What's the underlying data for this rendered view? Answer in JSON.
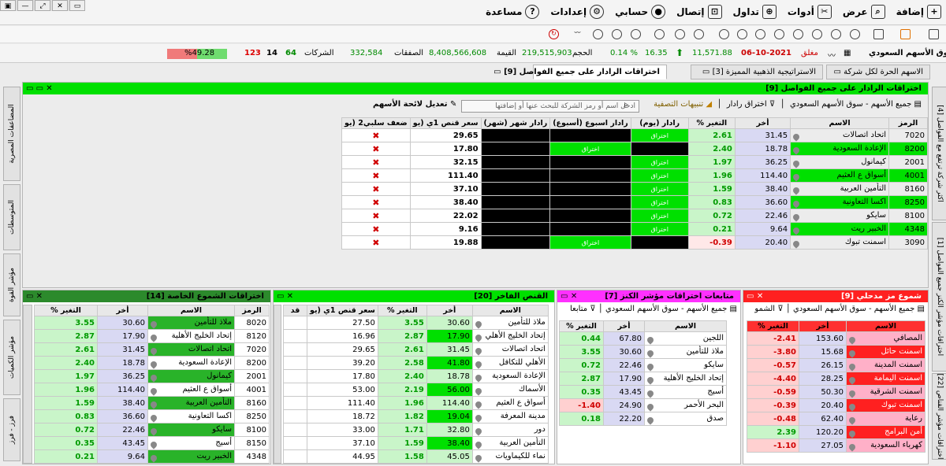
{
  "window_controls": [
    "▣",
    "—",
    "⤢",
    "✕",
    "▭"
  ],
  "menu": [
    {
      "label": "إضافة",
      "icon": "add-icon"
    },
    {
      "label": "عرض",
      "icon": "view-icon"
    },
    {
      "label": "أدوات",
      "icon": "tools-icon"
    },
    {
      "label": "تداول",
      "icon": "cart-icon"
    },
    {
      "label": "إتصال",
      "icon": "connect-icon"
    },
    {
      "label": "حسابي",
      "icon": "account-icon"
    },
    {
      "label": "إعدادات",
      "icon": "gear-icon"
    },
    {
      "label": "مساعدة",
      "icon": "help-icon"
    }
  ],
  "status": {
    "market": "سوق الأسهم السعودي",
    "state": "مغلق",
    "date": "06-10-2021",
    "index": "11,571.88",
    "change": "16.35",
    "change_pct": "0.14 %",
    "volume_label": "الحجم",
    "volume": "219,515,903",
    "value_label": "القيمة",
    "value": "8,408,566,608",
    "deals_label": "الصفقات",
    "deals": "332,584",
    "companies_label": "الشركات",
    "up": "64",
    "flat": "14",
    "down": "123",
    "breadth": "%49.28"
  },
  "tabs": [
    {
      "label": "الاسهم الحرة لكل شركة"
    },
    {
      "label": "الاستراتيجية الذهبية المميزة [3]"
    },
    {
      "label": "اختراقات الرادار على جميع الفواصل [9]"
    }
  ],
  "right_vtabs": [
    "اكثر شركة ترتفع مع الفواصل [4]",
    "اختراقات مؤشر الكنز جميع الفواصل [1]",
    "اختراقات موجة مع تحت خط الحافظ [3]",
    "اختراقات مؤشر القناص [22]"
  ],
  "left_vtabs": [
    "المضاعفات المصرية",
    "المتوسطات",
    "مؤشر القوة",
    "مؤشر الكميات",
    "فرز - فرز"
  ],
  "main": {
    "title": "اختراقات الرادار على جميع الفواصل [9]",
    "market_filter": "جميع الأسهم - سوق الأسهم السعودي",
    "radar_filter": "اختراق رادار",
    "alerts": "تنبيهات التصفية",
    "search_placeholder": "ادخل اسم أو رمز الشركة للبحث عنها أو إضافتها",
    "edit_list": "تعديل لائحة الأسهم",
    "headers": [
      "الرمز",
      "الاسم",
      "أخر",
      "التغير %",
      "رادار (يوم)",
      "رادار اسبوع (أسبوع)",
      "رادار شهر (شهر)",
      "سعر قنص 1ي (يو",
      "ضعف سلبي2 (يو"
    ],
    "rows": [
      {
        "code": "7020",
        "name": "اتحاد اتصالات",
        "last": "31.45",
        "chg": "2.61",
        "day": "اختراق",
        "week": "",
        "month": "bl",
        "snipe": "29.65"
      },
      {
        "code": "8200",
        "name": "الإعادة السعودية",
        "last": "18.78",
        "chg": "2.40",
        "day": "bl",
        "week": "اختراق",
        "month": "bl",
        "snipe": "17.80"
      },
      {
        "code": "2001",
        "name": "كيمانول",
        "last": "36.25",
        "chg": "1.97",
        "day": "اختراق",
        "week": "",
        "month": "bl",
        "snipe": "32.15"
      },
      {
        "code": "4001",
        "name": "أسواق ع العثيم",
        "last": "114.40",
        "chg": "1.96",
        "day": "اختراق",
        "week": "",
        "month": "bl",
        "snipe": "111.40"
      },
      {
        "code": "8160",
        "name": "التأمين العربية",
        "last": "38.40",
        "chg": "1.59",
        "day": "اختراق",
        "week": "",
        "month": "bl",
        "snipe": "37.10"
      },
      {
        "code": "8250",
        "name": "اكسا التعاونية",
        "last": "36.60",
        "chg": "0.83",
        "day": "اختراق",
        "week": "",
        "month": "bl",
        "snipe": "38.40"
      },
      {
        "code": "8100",
        "name": "سايكو",
        "last": "22.46",
        "chg": "0.72",
        "day": "اختراق",
        "week": "",
        "month": "bl",
        "snipe": "22.02"
      },
      {
        "code": "4348",
        "name": "الخبير ريت",
        "last": "9.64",
        "chg": "0.21",
        "day": "اختراق",
        "week": "",
        "month": "bl",
        "snipe": "9.16"
      },
      {
        "code": "3090",
        "name": "اسمنت تبوك",
        "last": "20.40",
        "chg": "-0.39",
        "day": "bl",
        "week": "اختراق",
        "month": "bl",
        "snipe": "19.88"
      }
    ]
  },
  "panels": {
    "p1": {
      "title": "شموع مز مدحلي [9]",
      "filter": "جميع الأسهم - سوق الأسهم السعودي",
      "extra": "الشمو",
      "headers": [
        "الاسم",
        "أخر",
        "التغير %"
      ],
      "rows": [
        [
          "المصافي",
          "153.60",
          "2.41-"
        ],
        [
          "اسمنت حائل",
          "15.68",
          "3.80-"
        ],
        [
          "اسمنت المدينة",
          "26.15",
          "0.57-"
        ],
        [
          "اسمنت اليمامة",
          "28.25",
          "4.40-"
        ],
        [
          "اسمنت الشرقية",
          "50.30",
          "0.59-"
        ],
        [
          "اسمنت تبوك",
          "20.40",
          "0.39-"
        ],
        [
          "رعاية",
          "62.40",
          "0.48-"
        ],
        [
          "أمن البرامج",
          "120.20",
          "2.39"
        ],
        [
          "كهرباء السعودية",
          "27.05",
          "1.10-"
        ]
      ]
    },
    "p2": {
      "title": "متابعات اختراقات مؤشر الكنز [7]",
      "filter": "جميع الأسهم - سوق الأسهم السعودي",
      "extra": "متابعا",
      "headers": [
        "الاسم",
        "أخر",
        "التغير %"
      ],
      "rows": [
        [
          "اللجين",
          "67.80",
          "0.44"
        ],
        [
          "ملاذ للتأمين",
          "30.60",
          "3.55"
        ],
        [
          "سايكو",
          "22.46",
          "0.72"
        ],
        [
          "إتحاد الخليج الأهلية",
          "17.90",
          "2.87"
        ],
        [
          "أسيج",
          "43.45",
          "0.35"
        ],
        [
          "البحر الأحمر",
          "24.90",
          "1.40-"
        ],
        [
          "صدق",
          "22.20",
          "0.18"
        ]
      ]
    },
    "p3": {
      "title": "القنص الفاخر [20]",
      "headers": [
        "الاسم",
        "أخر",
        "التغير %",
        "سعر قنص 1ي (يو",
        "قد"
      ],
      "rows": [
        [
          "ملاذ للتأمين",
          "30.60",
          "3.55",
          "27.50"
        ],
        [
          "إتحاد الخليج الأهلي",
          "17.90",
          "2.87",
          "16.96"
        ],
        [
          "اتحاد اتصالات",
          "31.45",
          "2.61",
          "29.65"
        ],
        [
          "الأهلي للتكافل",
          "41.80",
          "2.58",
          "39.20"
        ],
        [
          "الإعادة السعودية",
          "18.78",
          "2.40",
          "17.80"
        ],
        [
          "الأسماك",
          "56.00",
          "2.19",
          "53.00"
        ],
        [
          "أسواق ع العثيم",
          "114.40",
          "1.96",
          "111.40"
        ],
        [
          "مدينة المعرفة",
          "19.04",
          "1.82",
          "18.72"
        ],
        [
          "دور",
          "32.80",
          "1.71",
          "33.00"
        ],
        [
          "التأمين العربية",
          "38.40",
          "1.59",
          "37.10"
        ],
        [
          "نماء للكيماويات",
          "45.05",
          "1.58",
          "44.95"
        ]
      ]
    },
    "p4": {
      "title": "اختراقات الشموع الخاصة [14]",
      "headers": [
        "الرمز",
        "الاسم",
        "أخر",
        "التغير %"
      ],
      "rows": [
        [
          "8020",
          "ملاذ للتأمين",
          "30.60",
          "3.55"
        ],
        [
          "8120",
          "إتحاد الخليج الأهلية",
          "17.90",
          "2.87"
        ],
        [
          "7020",
          "اتحاد اتصالات",
          "31.45",
          "2.61"
        ],
        [
          "8200",
          "الإعادة السعودية",
          "18.78",
          "2.40"
        ],
        [
          "2001",
          "كيمانول",
          "36.25",
          "1.97"
        ],
        [
          "4001",
          "أسواق ع العثيم",
          "114.40",
          "1.96"
        ],
        [
          "8160",
          "التأمين العربية",
          "38.40",
          "1.59"
        ],
        [
          "8250",
          "اكسا التعاونية",
          "36.60",
          "0.83"
        ],
        [
          "8100",
          "سايكو",
          "22.46",
          "0.72"
        ],
        [
          "8150",
          "أسيج",
          "43.45",
          "0.35"
        ],
        [
          "4348",
          "الخبير ريت",
          "9.64",
          "0.21"
        ]
      ]
    }
  }
}
